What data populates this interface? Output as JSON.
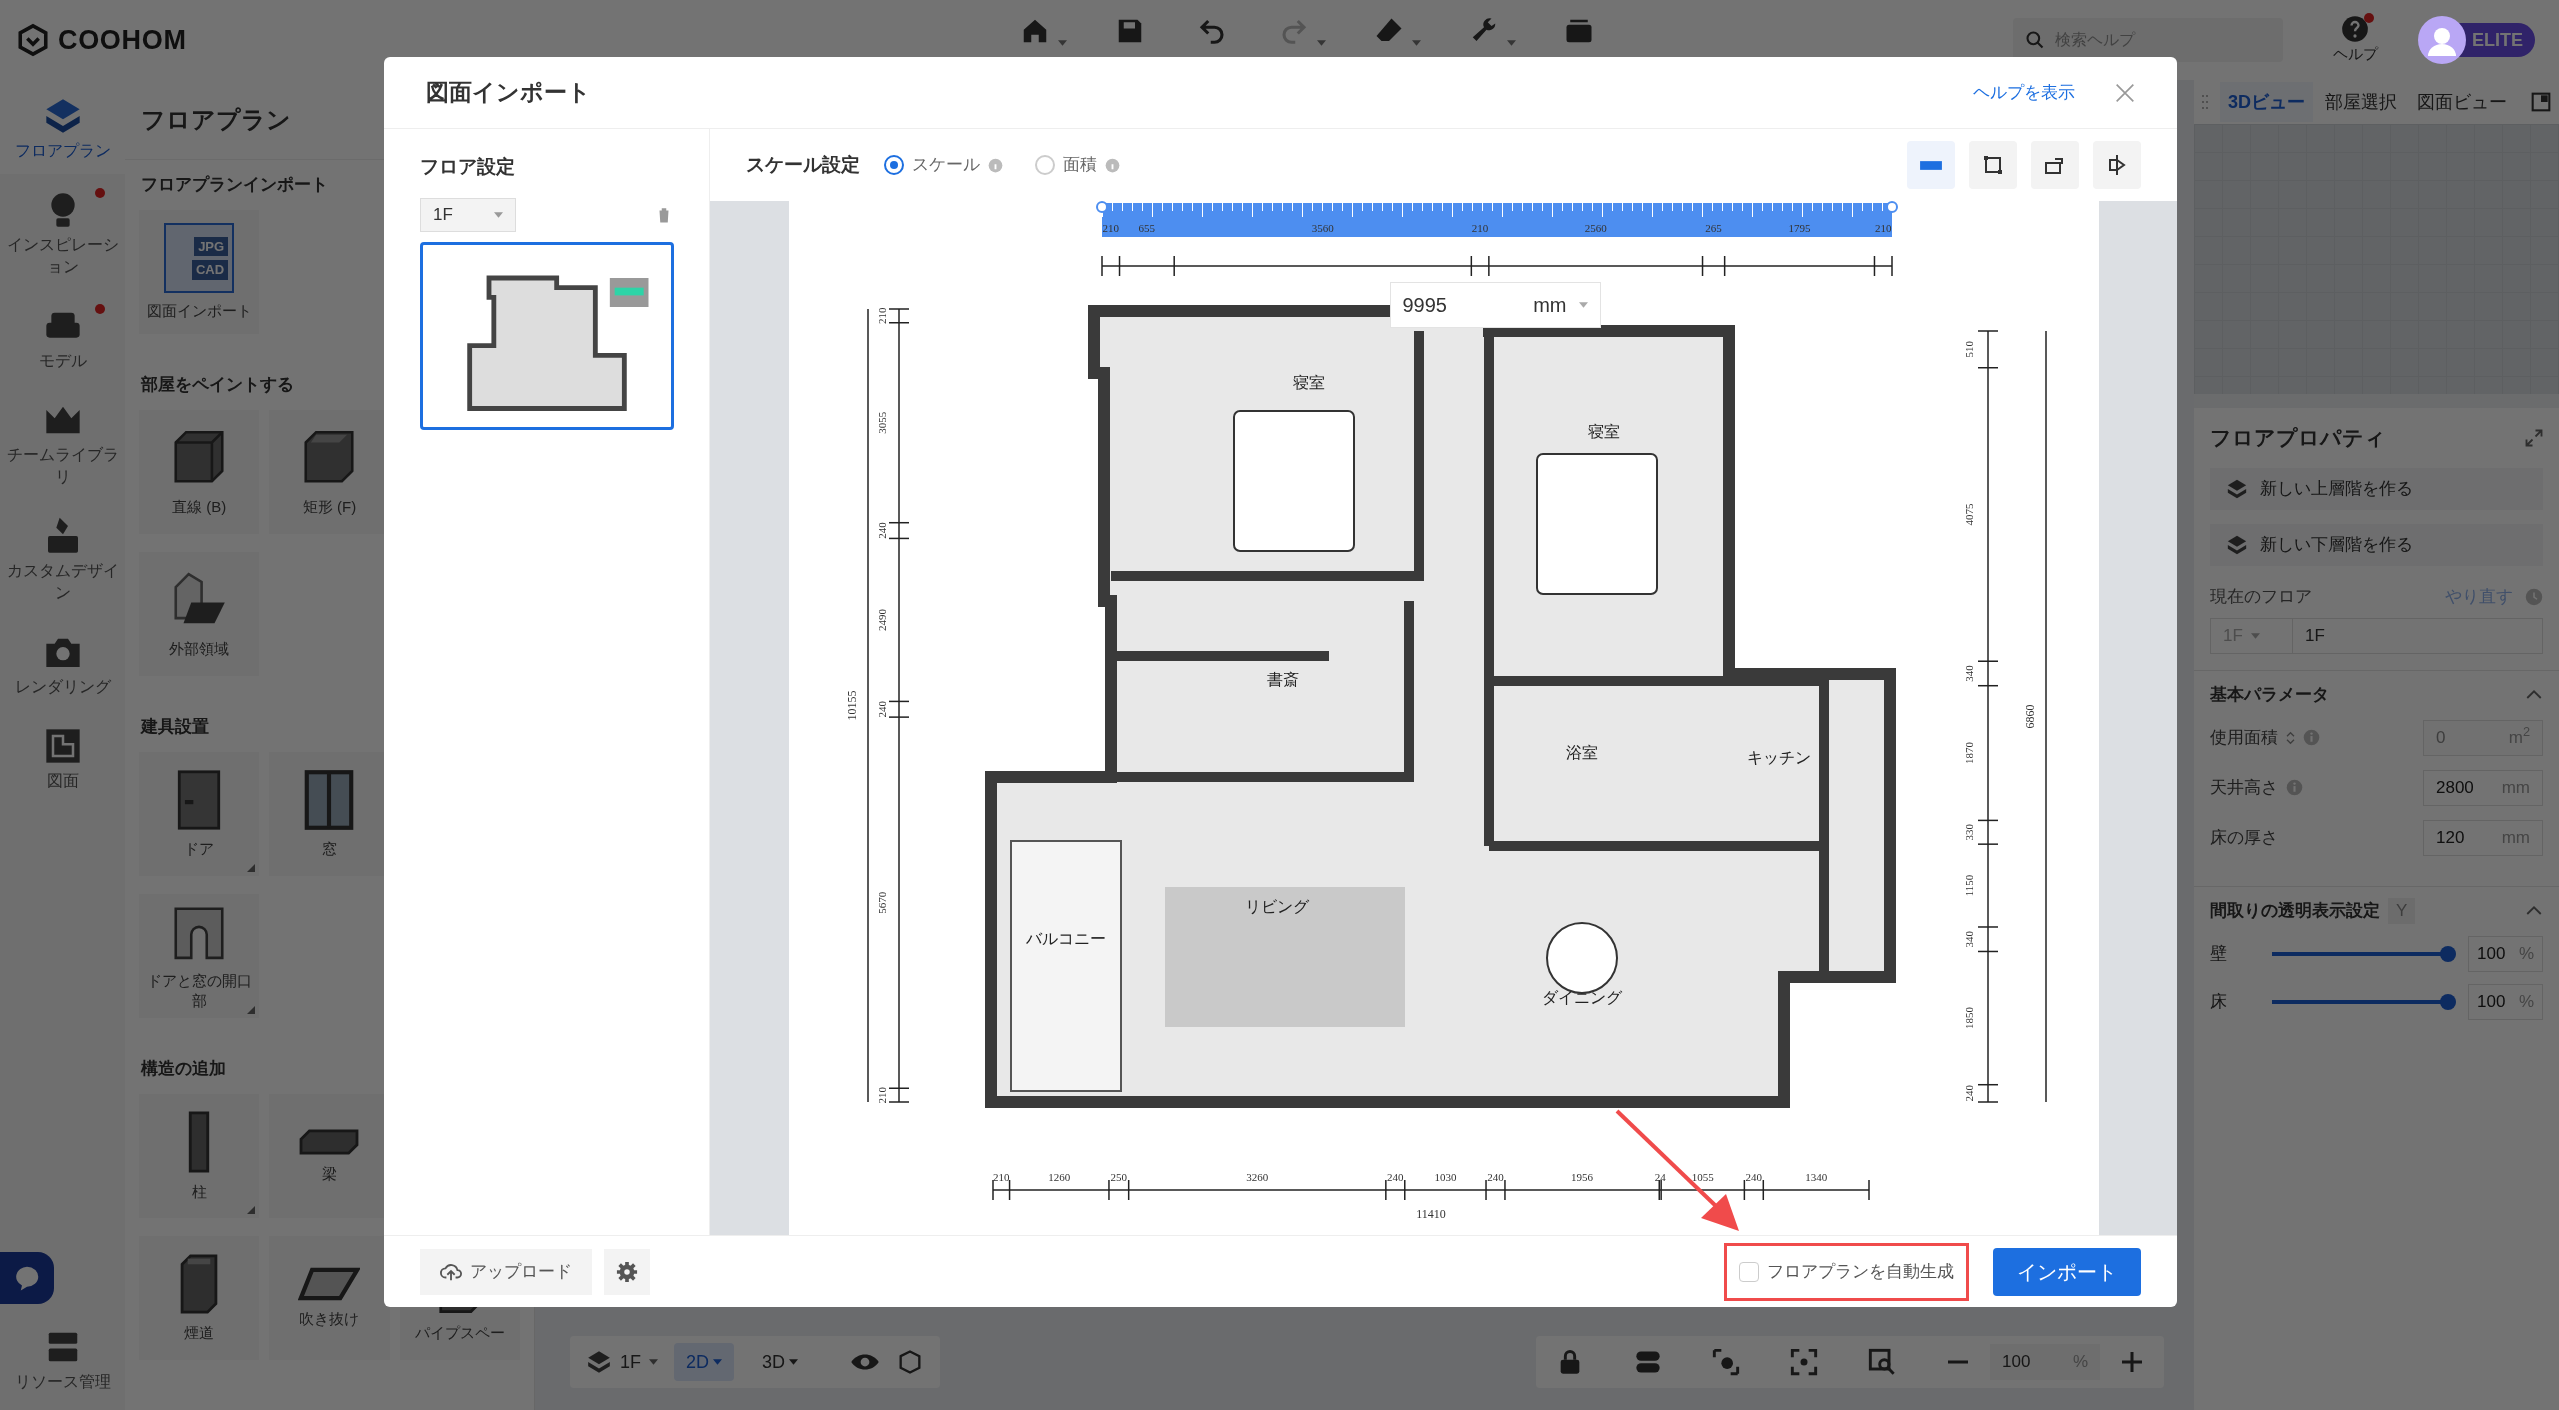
{
  "app_bar": {
    "logo": "COOHOM",
    "tools": [
      {
        "caret": true,
        "disabled": false
      },
      {
        "caret": false,
        "disabled": false
      },
      {
        "caret": false,
        "disabled": false
      },
      {
        "caret": true,
        "disabled": true
      },
      {
        "caret": true,
        "disabled": false
      },
      {
        "caret": true,
        "disabled": false
      },
      {
        "caret": false,
        "disabled": false
      }
    ],
    "search": {
      "placeholder": "検索ヘルプ"
    },
    "help": {
      "label": "ヘルプ",
      "notification": true
    },
    "badge": "ELITE"
  },
  "nav_rail": [
    {
      "label": "フロアプラン",
      "selected": true,
      "dot": false
    },
    {
      "label": "インスピレーション",
      "selected": false,
      "dot": true
    },
    {
      "label": "モデル",
      "selected": false,
      "dot": true
    },
    {
      "label": "チームライブラリ",
      "selected": false,
      "dot": false
    },
    {
      "label": "カスタムデザイン",
      "selected": false,
      "dot": false
    },
    {
      "label": "レンダリング",
      "selected": false,
      "dot": false
    },
    {
      "label": "図面",
      "selected": false,
      "dot": false
    }
  ],
  "nav_footer": {
    "label": "リソース管理"
  },
  "tool_panel": {
    "title": "フロアプラン",
    "sections": [
      {
        "title": "フロアプランインポート",
        "rows": [
          [
            {
              "label": "図面インポート",
              "tags": [
                "JPG",
                "CAD"
              ],
              "submenu": false
            }
          ]
        ]
      },
      {
        "title": "部屋をペイントする",
        "rows": [
          [
            {
              "label": "直線 (B)",
              "submenu": false
            },
            {
              "label": "矩形 (F)",
              "submenu": false
            }
          ],
          [
            {
              "label": "外部領域",
              "submenu": false
            }
          ]
        ]
      },
      {
        "title": "建具設置",
        "rows": [
          [
            {
              "label": "ドア",
              "submenu": true
            },
            {
              "label": "窓",
              "submenu": false
            }
          ],
          [
            {
              "label": "ドアと窓の開口部",
              "submenu": true
            }
          ]
        ]
      },
      {
        "title": "構造の追加",
        "rows": [
          [
            {
              "label": "柱",
              "submenu": true
            },
            {
              "label": "梁",
              "submenu": false
            }
          ],
          [
            {
              "label": "煙道",
              "submenu": false
            },
            {
              "label": "吹き抜け",
              "submenu": false
            },
            {
              "label": "パイプスペー",
              "submenu": false
            }
          ]
        ]
      }
    ]
  },
  "view_tabs": [
    {
      "label": "3Dビュー",
      "selected": true
    },
    {
      "label": "部屋選択",
      "selected": false
    },
    {
      "label": "図面ビュー",
      "selected": false
    }
  ],
  "floor_properties": {
    "title": "フロアプロパティ",
    "actions": [
      "新しい上層階を作る",
      "新しい下層階を作る"
    ],
    "current_floor": {
      "label": "現在のフロア",
      "link": "やり直す",
      "select": "1F",
      "name": "1F"
    },
    "basic": {
      "title": "基本パラメータ",
      "expanded": true,
      "fields": [
        {
          "label": "使用面積",
          "value": "0",
          "unit": "m$^{2}$",
          "disabled": true,
          "info": true,
          "sort": true
        },
        {
          "label": "天井高さ",
          "value": "2800",
          "unit": "mm",
          "disabled": false,
          "info": true,
          "sort": false
        },
        {
          "label": "床の厚さ",
          "value": "120",
          "unit": "mm",
          "disabled": false,
          "info": false,
          "sort": false
        }
      ]
    },
    "transparency": {
      "title": "間取りの透明表示設定",
      "key": "Y",
      "expanded": true,
      "sliders": [
        {
          "label": "壁",
          "level": 1,
          "value": "100",
          "unit": "%"
        },
        {
          "label": "床",
          "level": 1,
          "value": "100",
          "unit": "%"
        }
      ]
    }
  },
  "view_toolbar": {
    "floor": "1F",
    "modes": [
      {
        "label": "2D",
        "selected": true
      },
      {
        "label": "3D",
        "selected": false
      }
    ],
    "zoom": {
      "value": "100",
      "unit": "%"
    }
  },
  "import_dialog": {
    "title": "図面インポート",
    "help_link": "ヘルプを表示",
    "floor_settings": {
      "title": "フロア設定",
      "floor": "1F",
      "thumbnails": [
        {
          "selected": true
        }
      ]
    },
    "scale_settings": {
      "title": "スケール設定",
      "modes": [
        {
          "label": "スケール",
          "selected": true
        },
        {
          "label": "面積",
          "selected": false
        }
      ],
      "tools": [
        {
          "selected": true
        },
        {
          "selected": false
        },
        {
          "selected": false
        },
        {
          "selected": false
        }
      ]
    },
    "plan": {
      "top_dims": [
        "210",
        "655",
        "3560",
        "210",
        "2560",
        "265",
        "1795",
        "210"
      ],
      "left_dims": [
        "210",
        "3055",
        "240",
        "2490",
        "240",
        "5670",
        "210"
      ],
      "left_total": "10155",
      "right_dims": [
        "510",
        "4075",
        "340",
        "1870",
        "330",
        "1150",
        "340",
        "1850",
        "240"
      ],
      "right_total": "6860",
      "bottom_dims": [
        "210",
        "1260",
        "250",
        "3260",
        "240",
        "1030",
        "240",
        "1956",
        "24",
        "1055",
        "240",
        "1340"
      ],
      "bottom_total": "11410",
      "rooms": [
        "寝室",
        "寝室",
        "書斎",
        "浴室",
        "キッチン",
        "リビング",
        "バルコニー",
        "ダイニング"
      ],
      "measure": {
        "value": "9995",
        "unit": "mm"
      }
    },
    "footer": {
      "upload": "アップロード",
      "auto_generate": {
        "label": "フロアプランを自動生成",
        "checked": false,
        "highlighted": true
      },
      "import": "インポート"
    }
  }
}
